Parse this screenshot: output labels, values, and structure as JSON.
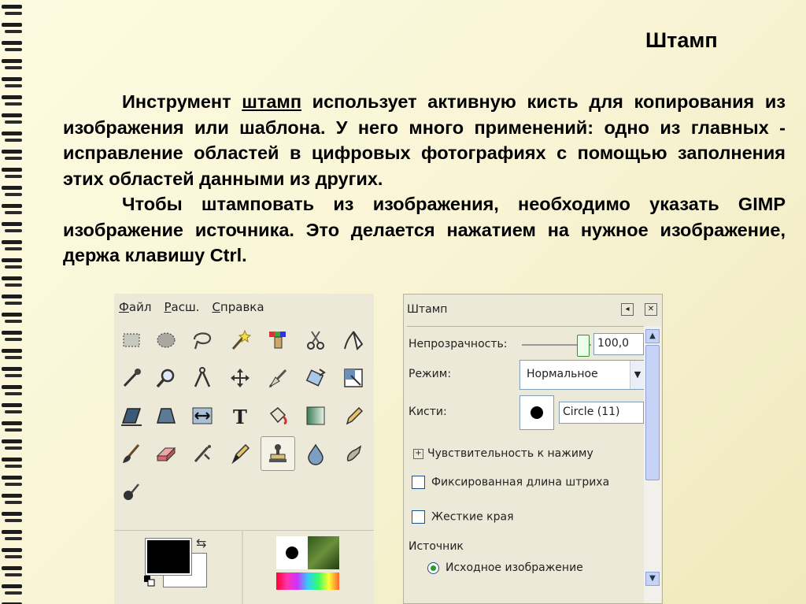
{
  "slide": {
    "title": "Штамп",
    "para1_before": "Инструмент ",
    "para1_keyword": "штамп",
    "para1_after": " использует активную кисть для копирования из изображения или шаблона. У него много применений: одно из главных - исправление областей в цифровых фотографиях с помощью заполнения этих областей данными из других.",
    "para2": "Чтобы штамповать из изображения, необходимо указать GIMP изображение источника. Это делается нажатием на нужное изображение, держа клавишу Ctrl."
  },
  "toolbox": {
    "menu": [
      {
        "accel": "Ф",
        "rest": "айл"
      },
      {
        "accel": "Р",
        "rest": "асш."
      },
      {
        "accel": "С",
        "rest": "правка"
      }
    ],
    "tools": [
      "rect-select-icon",
      "ellipse-select-icon",
      "lasso-icon",
      "fuzzy-select-icon",
      "select-by-color-icon",
      "scissors-icon",
      "paths-icon",
      "color-picker-icon",
      "zoom-icon",
      "measure-icon",
      "move-icon",
      "crop-icon",
      "rotate-icon",
      "scale-icon",
      "shear-icon",
      "perspective-icon",
      "flip-icon",
      "text-icon",
      "bucket-fill-icon",
      "blend-icon",
      "pencil-icon",
      "paintbrush-icon",
      "eraser-icon",
      "airbrush-icon",
      "ink-icon",
      "clone-stamp-icon",
      "blur-icon",
      "smudge-icon",
      "dodge-burn-icon"
    ],
    "active_tool": "clone-stamp-icon",
    "fg_color": "#000000",
    "bg_color": "#ffffff"
  },
  "options": {
    "title": "Штамп",
    "opacity_label": "Непрозрачность:",
    "opacity_value": "100,0",
    "mode_label": "Режим:",
    "mode_value": "Нормальное",
    "brush_label": "Кисти:",
    "brush_value": "Circle (11)",
    "pressure_label": "Чувствительность к нажиму",
    "fixed_stroke_label": "Фиксированная длина штриха",
    "hard_edge_label": "Жесткие края",
    "source_label": "Источник",
    "source_option": "Исходное изображение"
  }
}
